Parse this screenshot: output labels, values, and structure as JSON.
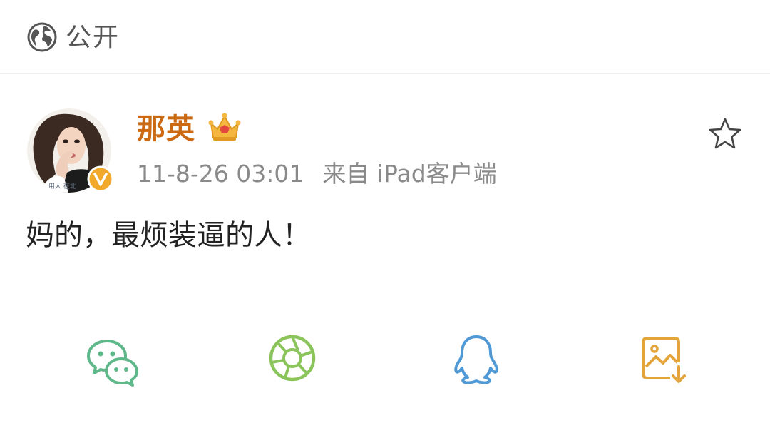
{
  "visibility": {
    "label": "公开",
    "icon": "globe-icon"
  },
  "post": {
    "username": "那英",
    "user_badge_icon": "crown-icon",
    "verified_icon": "verified-v-badge",
    "time": "11-8-26 03:01",
    "source": "来自 iPad客户端",
    "text": "妈的，最烦装逼的人！",
    "favorite_icon": "star-outline-icon"
  },
  "share": [
    {
      "icon": "wechat-icon",
      "color": "#5fb88a"
    },
    {
      "icon": "moments-icon",
      "color": "#8ac45a"
    },
    {
      "icon": "qq-icon",
      "color": "#4f9ad6"
    },
    {
      "icon": "save-image-icon",
      "color": "#e3a43a"
    }
  ],
  "colors": {
    "username": "#cc6a14",
    "meta": "#8a8a8a",
    "text": "#222222",
    "verified": "#f1a82b"
  }
}
